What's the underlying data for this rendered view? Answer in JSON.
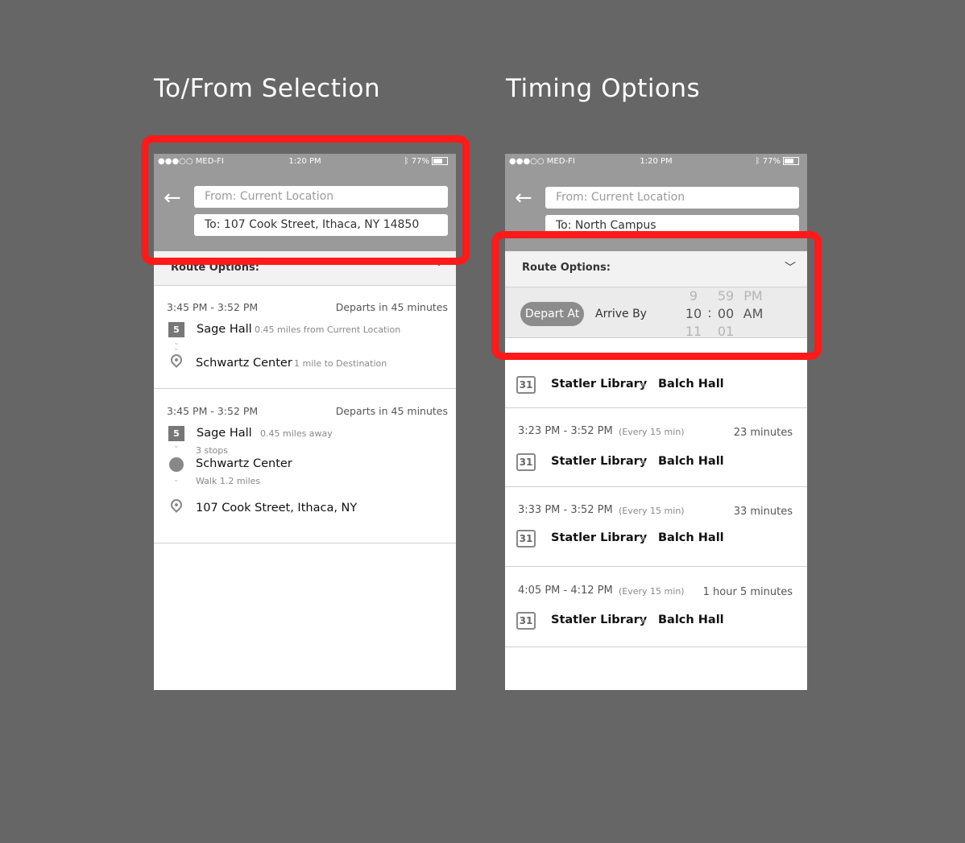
{
  "left": {
    "heading": "To/From Selection",
    "status": {
      "carrier": "●●●○○ MED-FI",
      "time": "1:20 PM",
      "battery": "77%"
    },
    "from_placeholder": "From: Current Location",
    "to_value": "To: 107 Cook Street, Ithaca, NY 14850",
    "route_options_label": "Route Options:",
    "cards": [
      {
        "time_range": "3:45 PM - 3:52 PM",
        "departs": "Departs in 45 minutes",
        "route_number": "5",
        "stop1": "Sage Hall",
        "stop1_note": "0.45 miles from Current Location",
        "stop2": "Schwartz Center",
        "stop2_note": "1 mile to Destination"
      },
      {
        "time_range": "3:45 PM - 3:52 PM",
        "departs": "Departs in 45 minutes",
        "route_number": "5",
        "stop1": "Sage Hall",
        "stop1_note": "0.45 miles away",
        "stops_note": "3 stops",
        "stop2": "Schwartz Center",
        "walk_note": "Walk 1.2 miles",
        "destination": "107 Cook Street, Ithaca, NY"
      }
    ]
  },
  "right": {
    "heading": "Timing Options",
    "status": {
      "carrier": "●●●○○ MED-FI",
      "time": "1:20 PM",
      "battery": "77%"
    },
    "from_placeholder": "From: Current Location",
    "to_value": "To: North Campus",
    "route_options_label": "Route Options:",
    "depart_at": "Depart At",
    "arrive_by": "Arrive By",
    "picker": {
      "hours": [
        "9",
        "10",
        "11"
      ],
      "separator": ":",
      "minutes": [
        "59",
        "00",
        "01"
      ],
      "periods": [
        "PM",
        "AM"
      ]
    },
    "first_route": {
      "route_number": "31",
      "from": "Statler Library",
      "to": "Balch Hall"
    },
    "cards": [
      {
        "time_range": "3:23 PM - 3:52 PM",
        "frequency": "(Every 15 min)",
        "duration": "23 minutes",
        "route_number": "31",
        "from": "Statler Library",
        "to": "Balch Hall"
      },
      {
        "time_range": "3:33 PM - 3:52 PM",
        "frequency": "(Every 15 min)",
        "duration": "33 minutes",
        "route_number": "31",
        "from": "Statler Library",
        "to": "Balch Hall"
      },
      {
        "time_range": "4:05 PM - 4:12 PM",
        "frequency": "(Every 15 min)",
        "duration": "1 hour 5 minutes",
        "route_number": "31",
        "from": "Statler Library",
        "to": "Balch Hall"
      }
    ]
  }
}
